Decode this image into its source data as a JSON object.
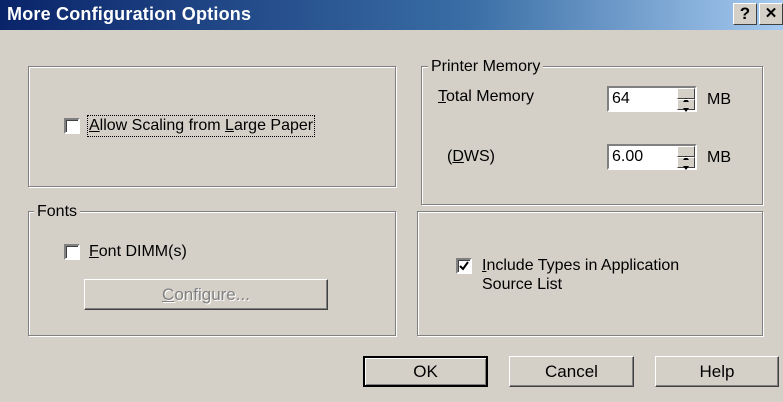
{
  "window": {
    "title": "More Configuration Options",
    "help_label": "?",
    "close_label": "✕"
  },
  "scaling_group": {
    "allow_scaling": {
      "prefix": "",
      "mnemonic": "A",
      "mid": "llow Scaling from ",
      "mnemonic2": "L",
      "suffix": "arge Paper",
      "checked": false
    }
  },
  "fonts_group": {
    "legend": "Fonts",
    "font_dimm": {
      "mnemonic": "F",
      "rest": "ont DIMM(s)",
      "checked": false
    },
    "configure": {
      "mnemonic": "C",
      "rest": "onfigure...",
      "enabled": false
    }
  },
  "memory_group": {
    "legend": "Printer Memory",
    "total_memory": {
      "mnemonic": "T",
      "rest": "otal Memory",
      "value": "64",
      "unit": "MB"
    },
    "dws": {
      "open": "(",
      "mnemonic": "D",
      "rest": "WS)",
      "value": "6.00",
      "unit": "MB"
    }
  },
  "types_group": {
    "include_types": {
      "line1": "nclude Types in Application",
      "mnemonic": "I",
      "line2": "Source List",
      "checked": true
    }
  },
  "buttons": {
    "ok": "OK",
    "cancel": "Cancel",
    "help": "Help"
  }
}
